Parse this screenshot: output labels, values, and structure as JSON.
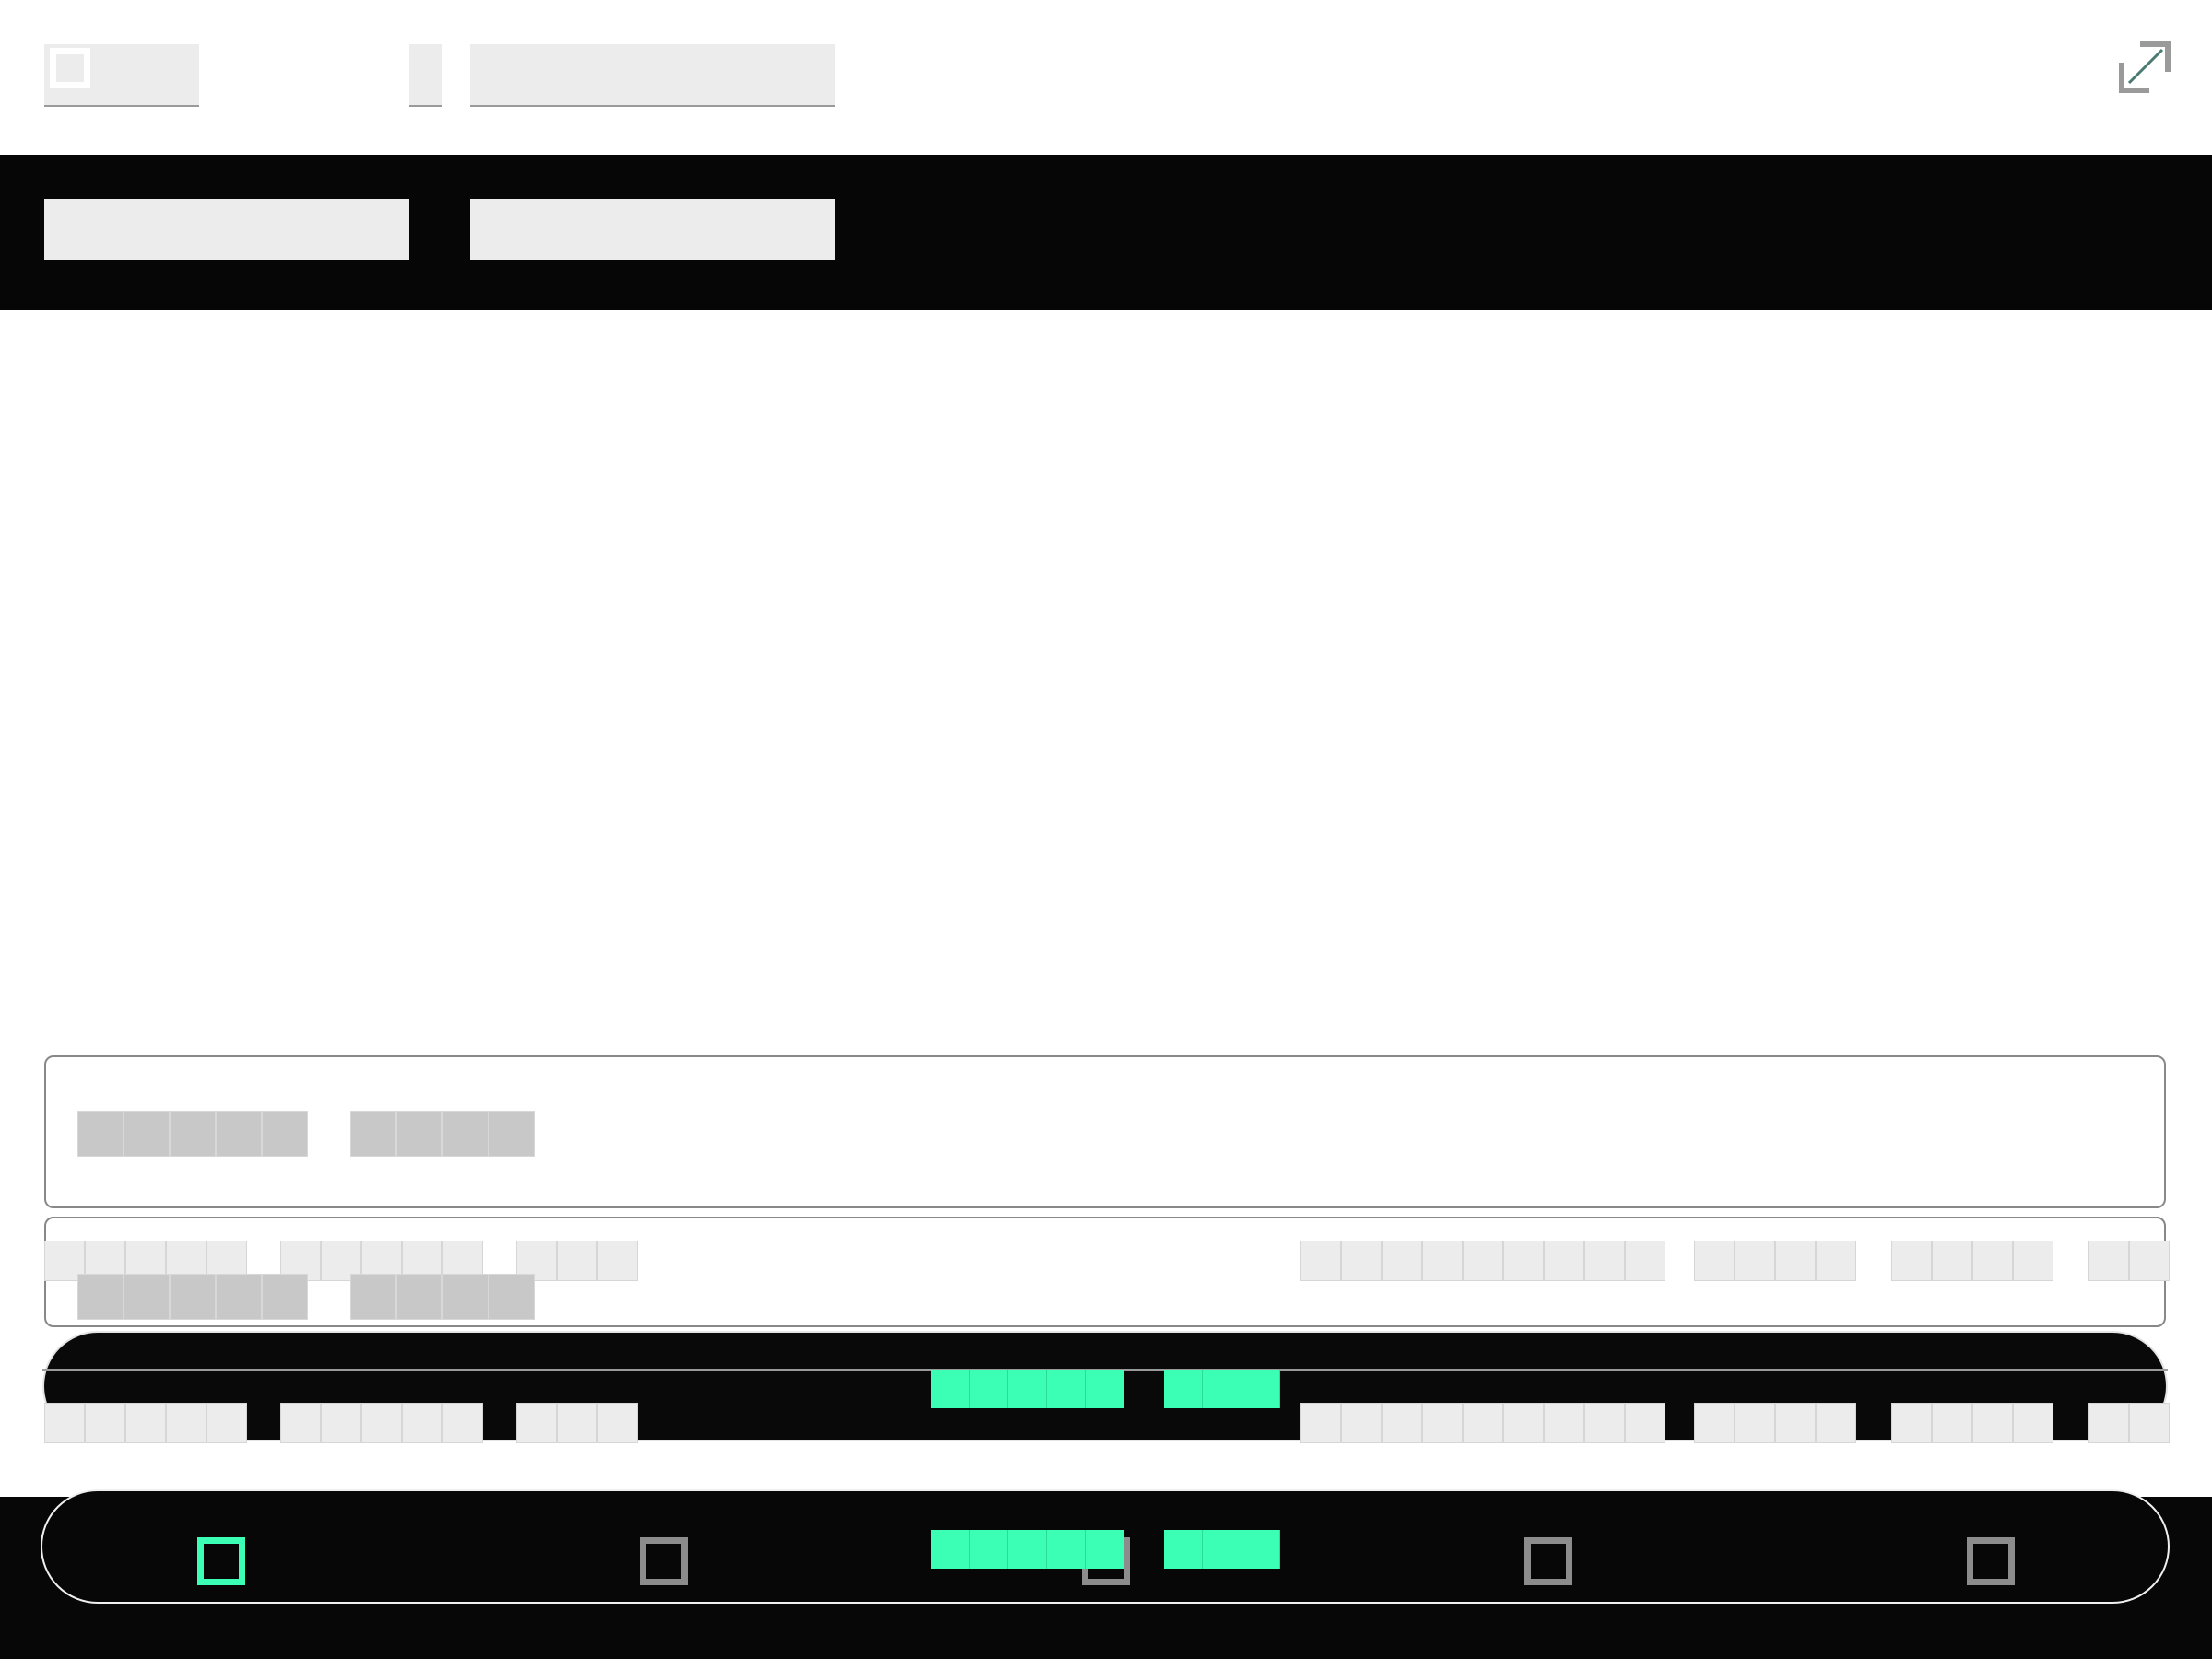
{
  "header": {
    "title": "",
    "breadcrumb_separator": "",
    "logo_icon": "app-logo-icon",
    "expand_icon": "expand-icon"
  },
  "tabs": [
    {
      "label": ""
    },
    {
      "label": ""
    }
  ],
  "empty_state": {
    "text": ""
  },
  "bottom_nav": {
    "items": [
      {
        "icon": "square-icon",
        "active": true
      },
      {
        "icon": "square-icon",
        "active": false
      },
      {
        "icon": "square-icon",
        "active": false
      },
      {
        "icon": "square-icon",
        "active": false
      },
      {
        "icon": "square-icon",
        "active": false
      }
    ]
  },
  "colors": {
    "accent": "#3affb4",
    "dark": "#060606",
    "placeholder": "#ececec",
    "placeholder_dark": "#c8c8c8",
    "inactive_icon": "#8c8c8c"
  }
}
